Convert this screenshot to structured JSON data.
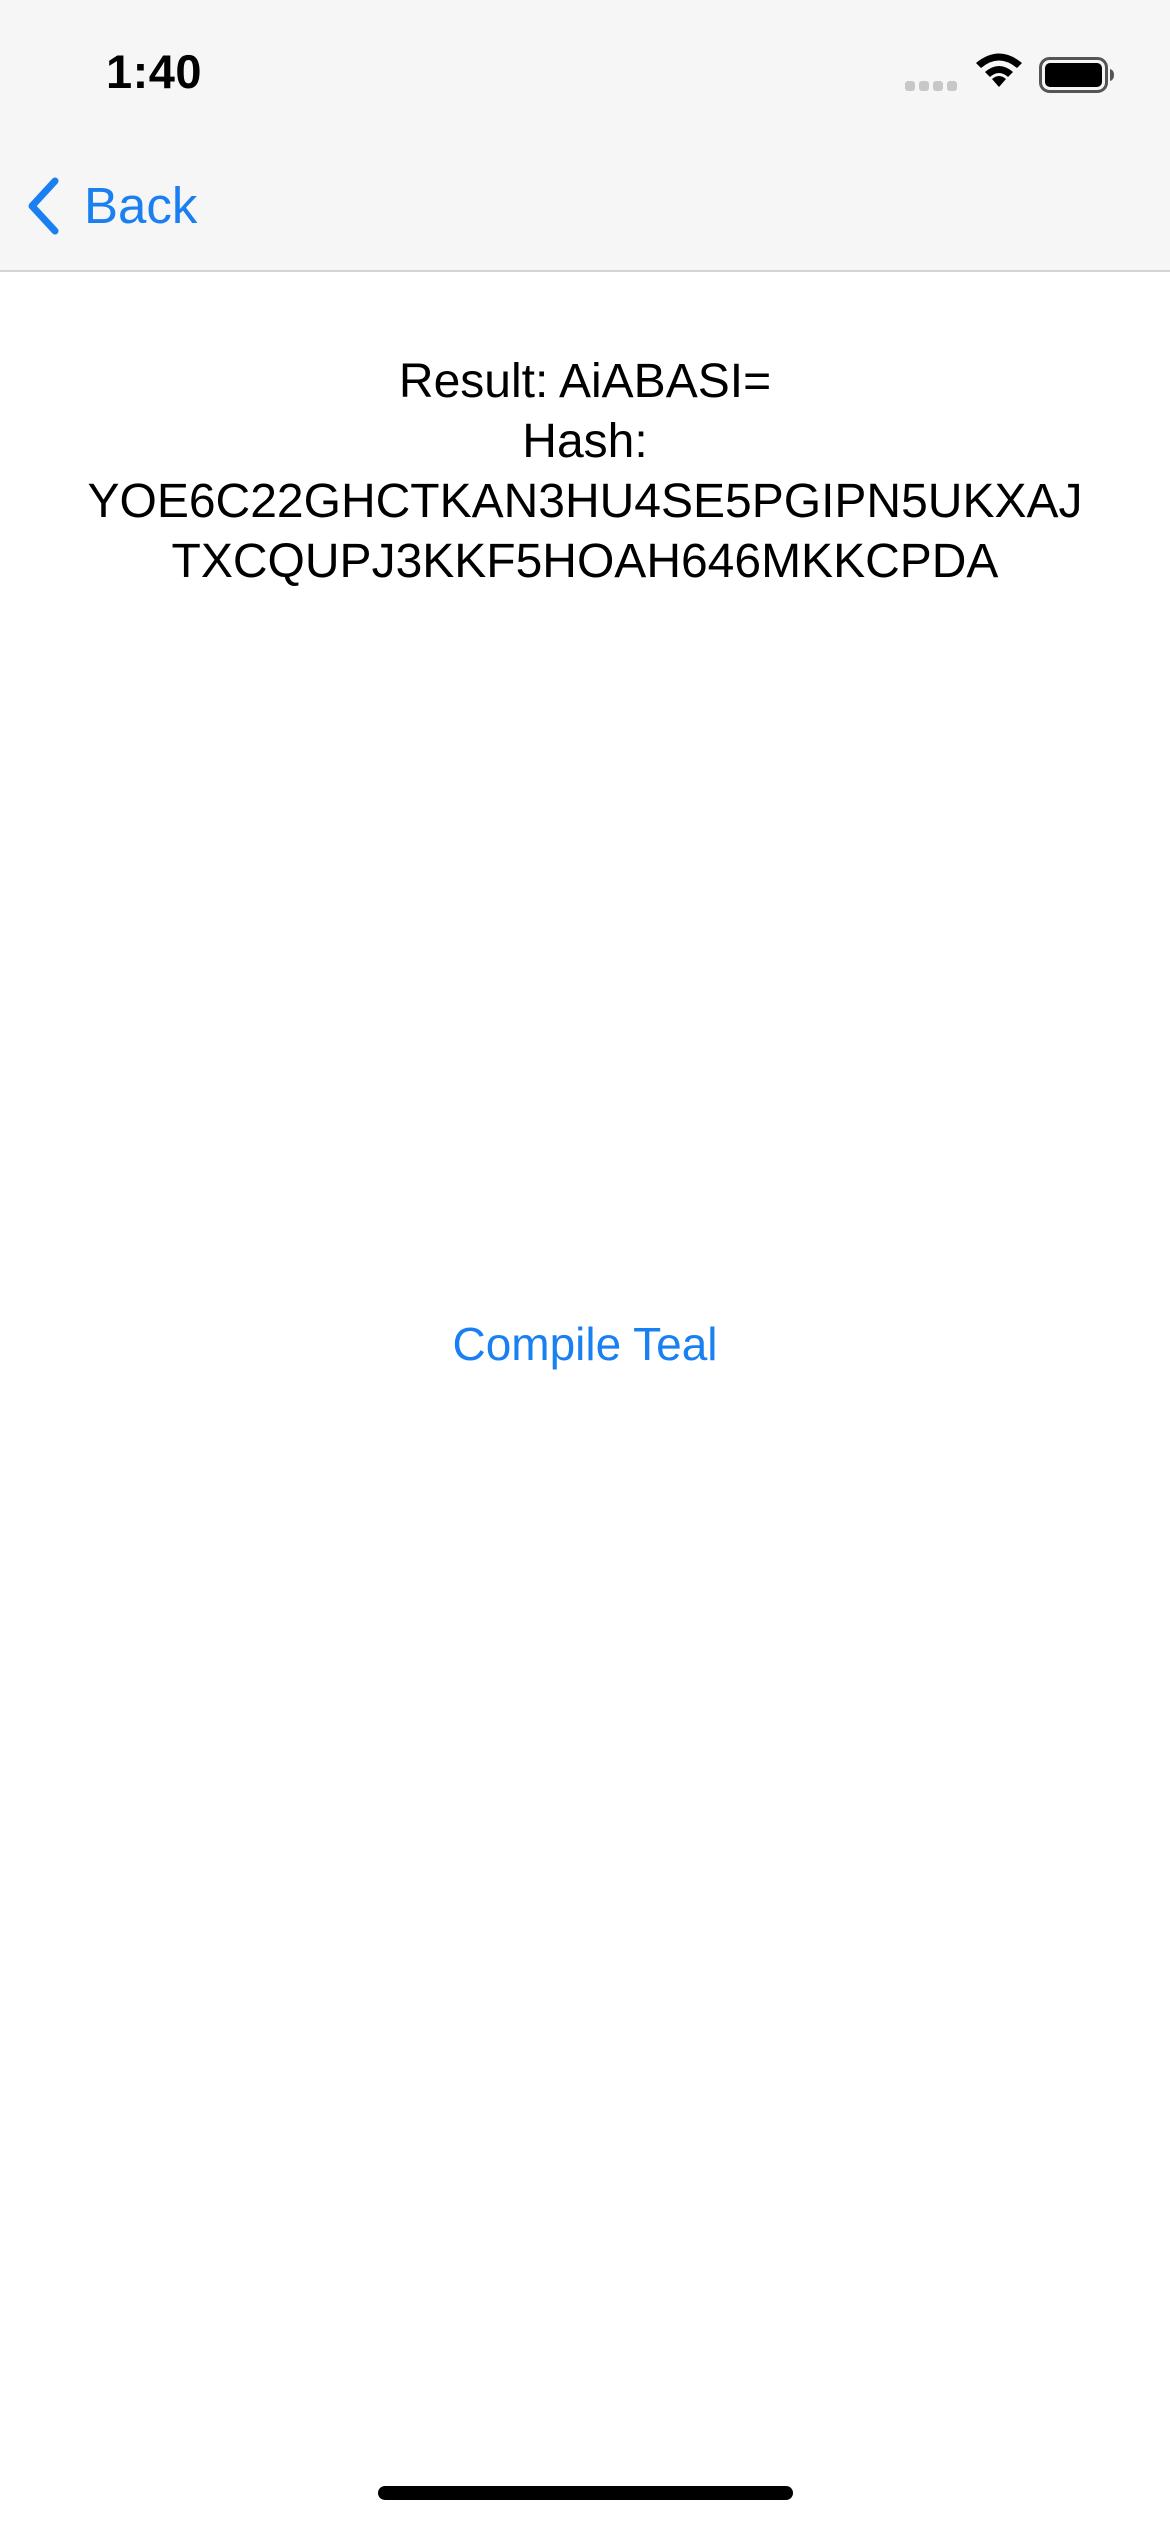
{
  "status_bar": {
    "time": "1:40",
    "icons": [
      "cellular-signal-icon",
      "wifi-icon",
      "battery-icon"
    ]
  },
  "nav_bar": {
    "back_label": "Back",
    "back_icon": "chevron-left-icon"
  },
  "result": {
    "line1": "Result: AiABASI=",
    "line2": "Hash:",
    "line3": "YOE6C22GHCTKAN3HU4SE5PGIPN5UKXAJ",
    "line4": "TXCQUPJ3KKF5HOAH646MKKCPDA"
  },
  "actions": {
    "compile_label": "Compile Teal"
  },
  "colors": {
    "accent": "#1a80f2",
    "nav_background": "#f6f6f6",
    "text": "#000000",
    "background": "#ffffff"
  }
}
